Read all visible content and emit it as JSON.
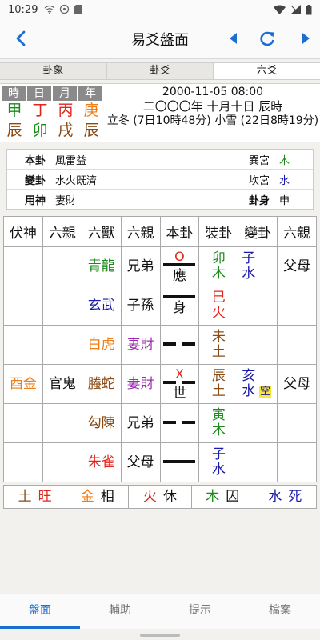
{
  "statusbar": {
    "time": "10:29"
  },
  "appbar": {
    "title": "易爻盤面"
  },
  "tabs": [
    {
      "label": "卦象",
      "active": false
    },
    {
      "label": "卦爻",
      "active": false
    },
    {
      "label": "六爻",
      "active": true
    }
  ],
  "pillars": {
    "headers": [
      "時",
      "日",
      "月",
      "年"
    ],
    "stems": [
      {
        "char": "甲",
        "color": "#1a8a1a"
      },
      {
        "char": "丁",
        "color": "#e0261b"
      },
      {
        "char": "丙",
        "color": "#e0261b"
      },
      {
        "char": "庚",
        "color": "#ef7d18"
      }
    ],
    "branches": [
      {
        "char": "辰",
        "color": "#8a4a12"
      },
      {
        "char": "卯",
        "color": "#1a8a1a"
      },
      {
        "char": "戌",
        "color": "#8a4a12"
      },
      {
        "char": "辰",
        "color": "#8a4a12"
      }
    ]
  },
  "date": {
    "gregorian": "2000-11-05 08:00",
    "lunar": "二〇〇〇年 十月十日 辰時",
    "solar_terms": "立冬 (7日10時48分) 小雪 (22日8時19分)"
  },
  "hexinfo": {
    "rows": [
      {
        "label": "本卦",
        "value": "風雷益",
        "label2": "巽宮",
        "value2": "木",
        "value2_color": "#1a8a1a"
      },
      {
        "label": "變卦",
        "value": "水火既濟",
        "label2": "坎宮",
        "value2": "水",
        "value2_color": "#1a1aa8"
      },
      {
        "label": "用神",
        "value": "妻財",
        "label2": "卦身",
        "label2_bold": true,
        "value2": "申",
        "value2_color": "#111111"
      }
    ]
  },
  "chart": {
    "headers": [
      "伏神",
      "六親",
      "六獸",
      "六親",
      "本卦",
      "裝卦",
      "變卦",
      "六親"
    ],
    "rows": [
      {
        "fushen": "",
        "fushen_color": "",
        "fushen_qin": "",
        "beast": "青龍",
        "beast_color": "#1a8a1a",
        "qin": "兄弟",
        "qin_color": "#111111",
        "line": "yang",
        "mark": "O",
        "shiying": "應",
        "zhuang": "卯木",
        "zhuang_color": "#1a8a1a",
        "bian": "子水",
        "bian_color": "#1a1aa8",
        "kong": "",
        "bian_qin": "父母"
      },
      {
        "fushen": "",
        "fushen_color": "",
        "fushen_qin": "",
        "beast": "玄武",
        "beast_color": "#1a1aa8",
        "qin": "子孫",
        "qin_color": "#111111",
        "line": "yang",
        "mark": "",
        "shiying": "身",
        "zhuang": "巳火",
        "zhuang_color": "#e0261b",
        "bian": "",
        "bian_color": "",
        "kong": "",
        "bian_qin": ""
      },
      {
        "fushen": "",
        "fushen_color": "",
        "fushen_qin": "",
        "beast": "白虎",
        "beast_color": "#ef7d18",
        "qin": "妻財",
        "qin_color": "#9b2fae",
        "line": "yin",
        "mark": "",
        "shiying": "",
        "zhuang": "未土",
        "zhuang_color": "#8a4a12",
        "bian": "",
        "bian_color": "",
        "kong": "",
        "bian_qin": ""
      },
      {
        "fushen": "酉金",
        "fushen_color": "#ef7d18",
        "fushen_qin": "官鬼",
        "beast": "螣蛇",
        "beast_color": "#8a4a12",
        "qin": "妻財",
        "qin_color": "#9b2fae",
        "line": "yin",
        "mark": "X",
        "shiying": "世",
        "zhuang": "辰土",
        "zhuang_color": "#8a4a12",
        "bian": "亥水",
        "bian_color": "#1a1aa8",
        "kong": "空",
        "bian_qin": "父母"
      },
      {
        "fushen": "",
        "fushen_color": "",
        "fushen_qin": "",
        "beast": "勾陳",
        "beast_color": "#8a4a12",
        "qin": "兄弟",
        "qin_color": "#111111",
        "line": "yin",
        "mark": "",
        "shiying": "",
        "zhuang": "寅木",
        "zhuang_color": "#1a8a1a",
        "bian": "",
        "bian_color": "",
        "kong": "",
        "bian_qin": ""
      },
      {
        "fushen": "",
        "fushen_color": "",
        "fushen_qin": "",
        "beast": "朱雀",
        "beast_color": "#e0261b",
        "qin": "父母",
        "qin_color": "#111111",
        "line": "yang",
        "mark": "",
        "shiying": "",
        "zhuang": "子水",
        "zhuang_color": "#1a1aa8",
        "bian": "",
        "bian_color": "",
        "kong": "",
        "bian_qin": ""
      }
    ]
  },
  "elements": [
    {
      "el": "土",
      "el_color": "#8a4a12",
      "state": "旺",
      "state_color": "#e0261b"
    },
    {
      "el": "金",
      "el_color": "#ef7d18",
      "state": "相",
      "state_color": "#111111"
    },
    {
      "el": "火",
      "el_color": "#e0261b",
      "state": "休",
      "state_color": "#111111"
    },
    {
      "el": "木",
      "el_color": "#1a8a1a",
      "state": "囚",
      "state_color": "#111111"
    },
    {
      "el": "水",
      "el_color": "#1a1aa8",
      "state": "死",
      "state_color": "#1a1aa8"
    }
  ],
  "bottomnav": [
    {
      "label": "盤面",
      "active": true
    },
    {
      "label": "輔助",
      "active": false
    },
    {
      "label": "提示",
      "active": false
    },
    {
      "label": "檔案",
      "active": false
    }
  ],
  "colors": {
    "accent": "#1a6fd0"
  }
}
